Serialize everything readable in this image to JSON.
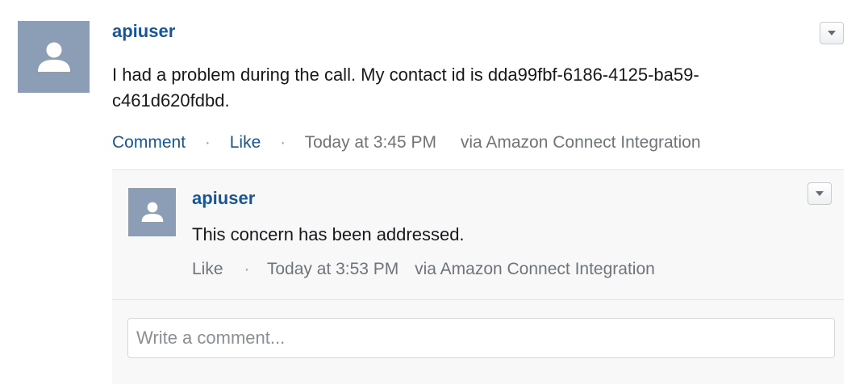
{
  "post": {
    "avatar_icon": "user-silhouette-icon",
    "author": "apiuser",
    "body": "I had a problem during the call. My contact id is dda99fbf-6186-4125-ba59-c461d620fdbd.",
    "actions": {
      "comment": "Comment",
      "like": "Like",
      "separator": "·",
      "timestamp": "Today at 3:45 PM",
      "source": "via Amazon Connect Integration"
    },
    "menu_icon": "caret-down-icon"
  },
  "comment": {
    "avatar_icon": "user-silhouette-icon",
    "author": "apiuser",
    "body": "This concern has been addressed.",
    "actions": {
      "like": "Like",
      "separator": "·",
      "timestamp": "Today at 3:53 PM",
      "source": "via Amazon Connect Integration"
    },
    "menu_icon": "caret-down-icon"
  },
  "composer": {
    "placeholder": "Write a comment...",
    "value": ""
  },
  "colors": {
    "link": "#195594",
    "avatar_bg": "#8b9eb6",
    "meta_text": "#6e7479",
    "comment_bg": "#f8f8f8"
  }
}
